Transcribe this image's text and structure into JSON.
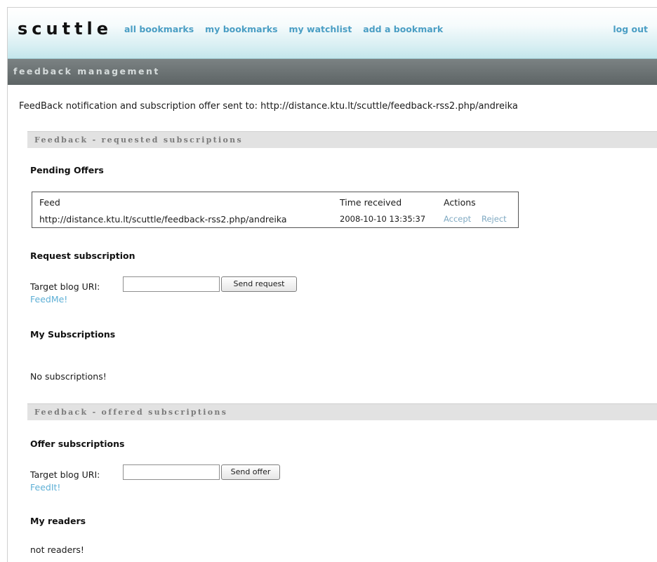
{
  "header": {
    "logo": "scuttle",
    "nav": [
      "all bookmarks",
      "my bookmarks",
      "my watchlist",
      "add a bookmark"
    ],
    "logout": "log out"
  },
  "subheader": {
    "title": "feedback management"
  },
  "notice": "FeedBack notification and subscription offer sent to: http://distance.ktu.lt/scuttle/feedback-rss2.php/andreika",
  "requested": {
    "section_title": "Feedback - requested subscriptions",
    "pending_heading": "Pending Offers",
    "table": {
      "headers": [
        "Feed",
        "Time received",
        "Actions"
      ],
      "rows": [
        {
          "feed": "http://distance.ktu.lt/scuttle/feedback-rss2.php/andreika",
          "time": "2008-10-10 13:35:37",
          "accept": "Accept",
          "reject": "Reject"
        }
      ]
    },
    "request_heading": "Request subscription",
    "target_label": "Target blog URI:",
    "target_value": "",
    "send_button": "Send request",
    "feed_link": "FeedMe!",
    "my_subscriptions_heading": "My Subscriptions",
    "no_subscriptions": "No subscriptions!"
  },
  "offered": {
    "section_title": "Feedback - offered subscriptions",
    "offer_heading": "Offer subscriptions",
    "target_label": "Target blog URI:",
    "target_value": "",
    "send_button": "Send offer",
    "feed_link": "FeedIt!",
    "readers_heading": "My readers",
    "no_readers": "not readers!"
  },
  "colors": {
    "link": "#4a9ec4",
    "header_gradient_bottom": "#c3e6ec",
    "subbar": "#5d6465",
    "section_bar": "#e2e2e2"
  }
}
